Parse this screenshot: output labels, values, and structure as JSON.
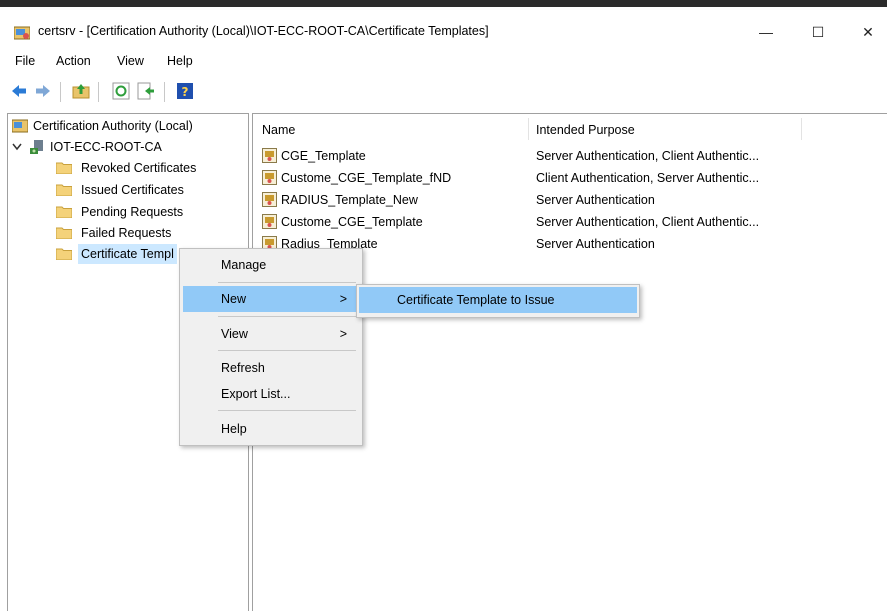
{
  "window": {
    "title": "certsrv - [Certification Authority (Local)\\IOT-ECC-ROOT-CA\\Certificate Templates]",
    "minimize": "—",
    "maximize": "☐",
    "close": "✕"
  },
  "menubar": [
    "File",
    "Action",
    "View",
    "Help"
  ],
  "tree": {
    "root": "Certification Authority (Local)",
    "ca": "IOT-ECC-ROOT-CA",
    "children": [
      "Revoked Certificates",
      "Issued Certificates",
      "Pending Requests",
      "Failed Requests",
      "Certificate Templ"
    ]
  },
  "list": {
    "columns": [
      "Name",
      "Intended Purpose"
    ],
    "rows": [
      {
        "name": "CGE_Template",
        "purpose": "Server Authentication, Client Authentic..."
      },
      {
        "name": "Custome_CGE_Template_fND",
        "purpose": "Client Authentication, Server Authentic..."
      },
      {
        "name": "RADIUS_Template_New",
        "purpose": "Server Authentication"
      },
      {
        "name": "Custome_CGE_Template",
        "purpose": "Server Authentication, Client Authentic..."
      },
      {
        "name": "Radius_Template",
        "purpose": "Server Authentication"
      }
    ]
  },
  "context_menu": {
    "items": [
      "Manage",
      "New",
      "View",
      "Refresh",
      "Export List...",
      "Help"
    ],
    "submenu_arrow": ">",
    "submenu": [
      "Certificate Template to Issue"
    ]
  },
  "colors": {
    "highlight": "#91c9f7",
    "selection": "#cce8ff",
    "menu_bg": "#f0f0f0"
  }
}
